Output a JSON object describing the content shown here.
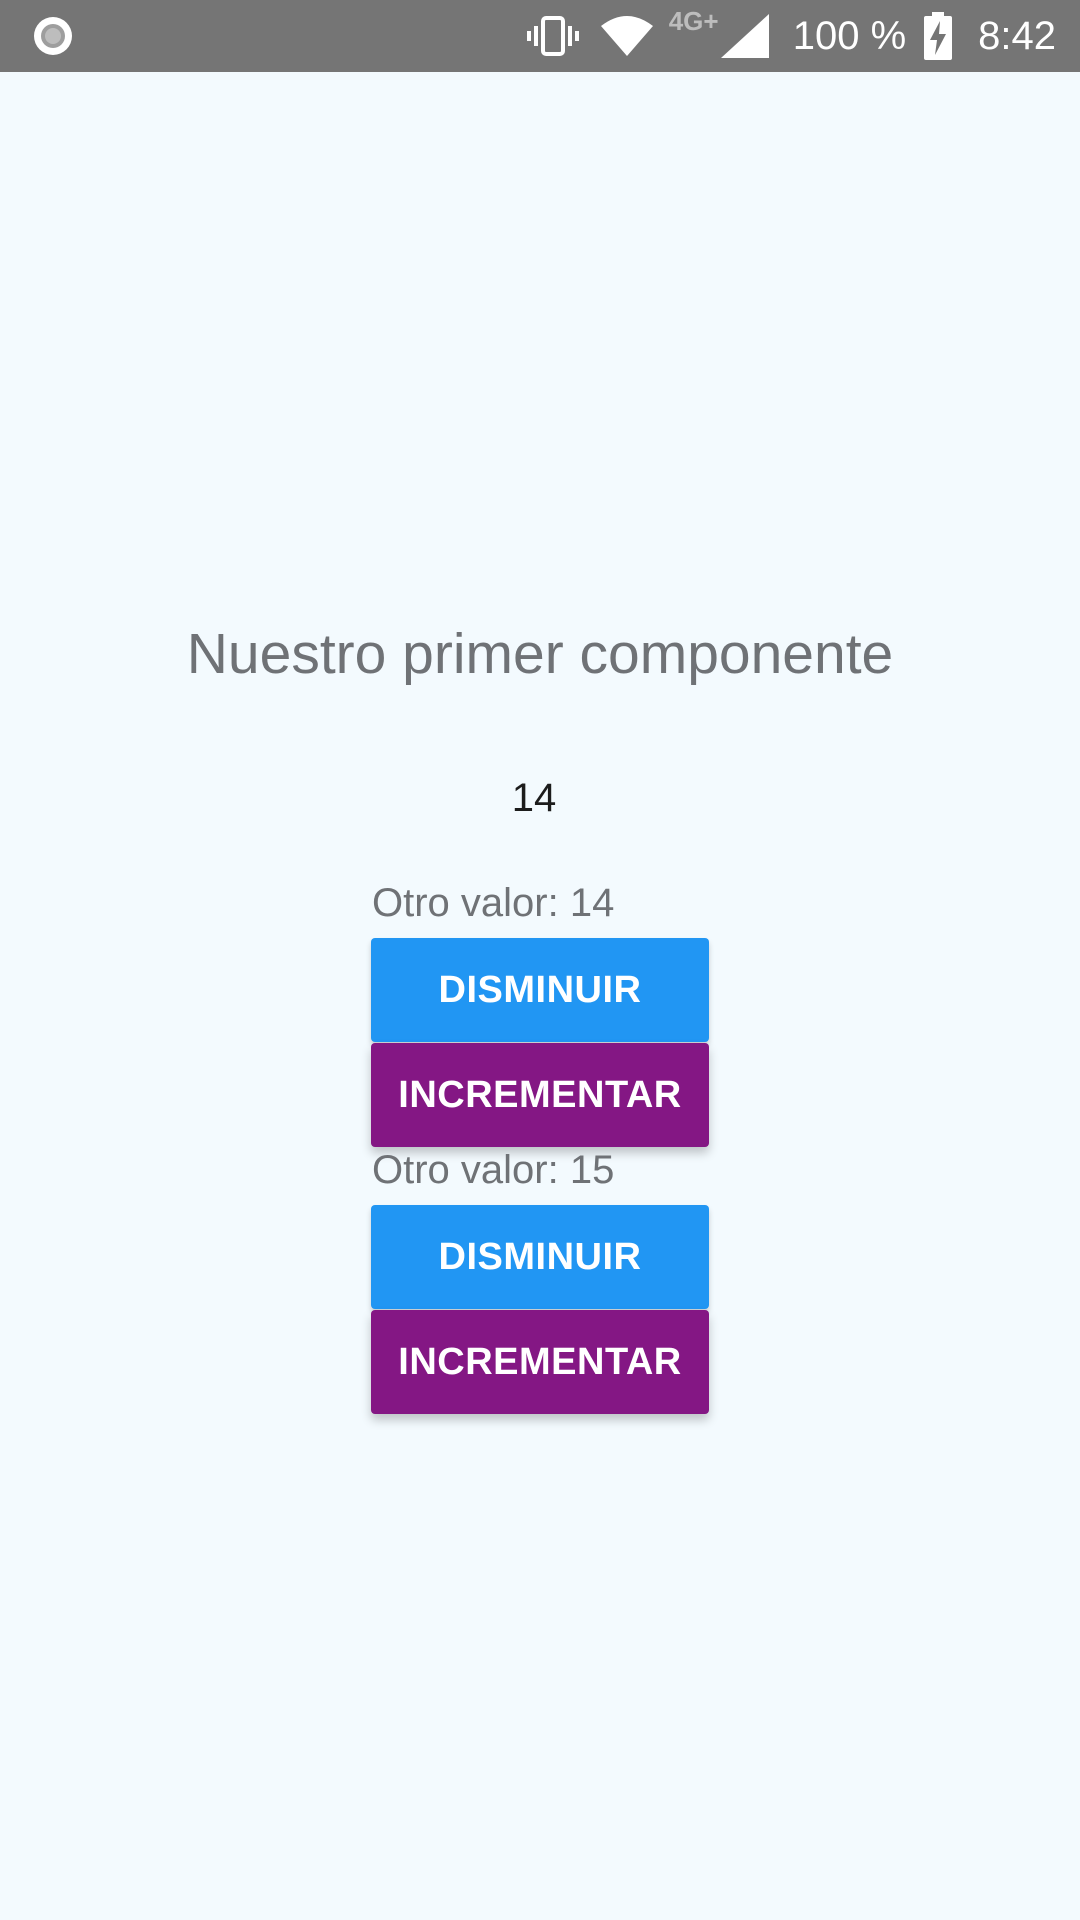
{
  "status_bar": {
    "icons": [
      "record-icon",
      "vibrate-icon",
      "wifi-icon",
      "signal-icon",
      "battery-charging-icon"
    ],
    "network_type": "4G+",
    "battery_text": "100 %",
    "time": "8:42",
    "background_color": "#757575"
  },
  "main": {
    "title": "Nuestro primer componente",
    "counter_value": "14",
    "background_color": "#F3FAFE",
    "blocks": [
      {
        "label": "Otro valor: 14",
        "decrement_label": "DISMINUIR",
        "increment_label": "INCREMENTAR"
      },
      {
        "label": "Otro valor: 15",
        "decrement_label": "DISMINUIR",
        "increment_label": "INCREMENTAR"
      }
    ],
    "colors": {
      "decrement_button": "#2196F3",
      "increment_button": "#841784",
      "title_text": "#6F7276"
    }
  }
}
